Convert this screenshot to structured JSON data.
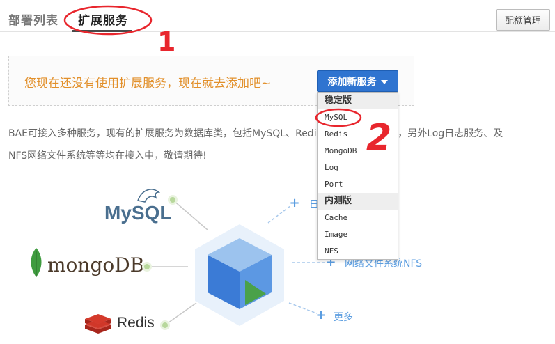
{
  "tabs": {
    "deploy_list": "部署列表",
    "ext_services": "扩展服务"
  },
  "header": {
    "quota_button": "配额管理"
  },
  "notice": {
    "text": "您现在还没有使用扩展服务，现在就去添加吧~",
    "add_button": "添加新服务"
  },
  "dropdown": {
    "stable_group": "稳定版",
    "stable_items": [
      "MySQL",
      "Redis",
      "MongoDB",
      "Log",
      "Port"
    ],
    "beta_group": "内测版",
    "beta_items": [
      "Cache",
      "Image",
      "NFS"
    ]
  },
  "description": {
    "line1": "BAE可接入多种服务，现有的扩展服务为数据库类，包括MySQL、Redis、MongoDB三种，另外Log日志服务、及",
    "line2": "NFS网络文件系统等等均在接入中，敬请期待!"
  },
  "diagram": {
    "mysql_logo": "MySQL",
    "mongodb_logo": "mongoDB",
    "redis_logo": "Redis",
    "right_top_label": "日",
    "right_mid_label": "网络文件系统NFS",
    "right_bottom_label": "更多"
  },
  "annotations": {
    "mark_1": "1",
    "mark_2": "2"
  },
  "colors": {
    "accent": "#2f74d0",
    "notice_text": "#e2902b",
    "annotation": "#e8262d"
  }
}
